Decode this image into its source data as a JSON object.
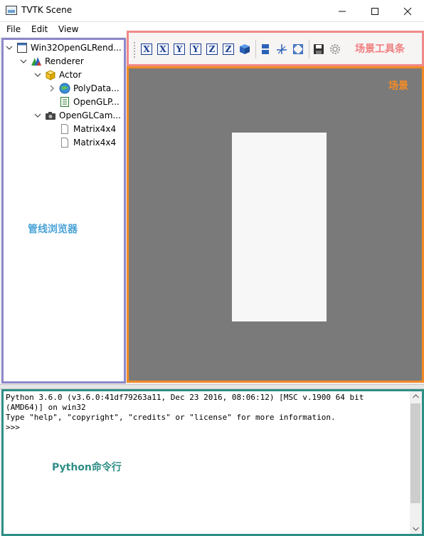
{
  "window": {
    "title": "TVTK Scene",
    "minimize": "—",
    "maximize": "☐",
    "close": "✕"
  },
  "menu": {
    "items": [
      {
        "label": "File"
      },
      {
        "label": "Edit"
      },
      {
        "label": "View"
      }
    ]
  },
  "tree": {
    "nodes": [
      {
        "label": "Win32OpenGLRend...",
        "icon": "render-window-icon",
        "expand": "expanded"
      },
      {
        "label": "Renderer",
        "icon": "renderer-icon",
        "expand": "expanded"
      },
      {
        "label": "Actor",
        "icon": "actor-cube-icon",
        "expand": "expanded"
      },
      {
        "label": "PolyData...",
        "icon": "polydata-globe-icon",
        "expand": "collapsed"
      },
      {
        "label": "OpenGLP...",
        "icon": "property-icon",
        "expand": "none"
      },
      {
        "label": "OpenGLCam...",
        "icon": "camera-icon",
        "expand": "expanded"
      },
      {
        "label": "Matrix4x4",
        "icon": "document-icon",
        "expand": "none"
      },
      {
        "label": "Matrix4x4",
        "icon": "document-icon",
        "expand": "none"
      }
    ],
    "annotation": "管线浏览器"
  },
  "toolbar": {
    "annotation": "场景工具条",
    "axis_buttons": [
      {
        "label": "X"
      },
      {
        "label": "X"
      },
      {
        "label": "Y"
      },
      {
        "label": "Y"
      },
      {
        "label": "Z"
      },
      {
        "label": "Z"
      }
    ],
    "icons": [
      "isometric-view-icon",
      "split-view-icon",
      "axes-icon",
      "full-screen-icon",
      "save-icon",
      "settings-icon"
    ]
  },
  "scene": {
    "annotation": "场景"
  },
  "console": {
    "lines": [
      "Python 3.6.0 (v3.6.0:41df79263a11, Dec 23 2016, 08:06:12) [MSC v.1900 64 bit",
      "(AMD64)] on win32",
      "Type \"help\", \"copyright\", \"credits\" or \"license\" for more information.",
      ">>>"
    ],
    "annotation": "Python命令行"
  },
  "colors": {
    "tree_border": "#8d88c9",
    "toolbar_border": "#f08a8a",
    "scene_border": "#f28b27",
    "scene_background": "#7a7a7a",
    "console_border": "#2f8e86"
  }
}
